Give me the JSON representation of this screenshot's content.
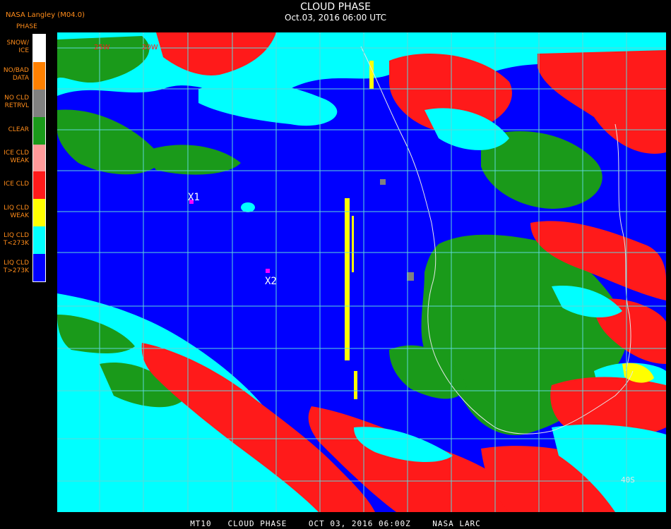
{
  "header": {
    "title": "CLOUD PHASE",
    "datetime": "Oct.03, 2016 06:00 UTC",
    "source": "NASA Langley (M04.0)"
  },
  "legend": {
    "title": "PHASE",
    "items": [
      {
        "label": "SNOW/\nICE",
        "color": "#ffffff"
      },
      {
        "label": "NO/BAD\nDATA",
        "color": "#ff8000"
      },
      {
        "label": "NO CLD\nRETRVL",
        "color": "#808080"
      },
      {
        "label": "CLEAR",
        "color": "#1a9a1a"
      },
      {
        "label": "ICE CLD\nWEAK",
        "color": "#ff9a9a"
      },
      {
        "label": "ICE CLD",
        "color": "#ff1a1a"
      },
      {
        "label": "LIQ CLD\nWEAK",
        "color": "#ffff00"
      },
      {
        "label": "LIQ CLD\nT<273K",
        "color": "#00ffff"
      },
      {
        "label": "LIQ CLD\nT>273K",
        "color": "#0000ff"
      }
    ]
  },
  "map": {
    "markers": [
      {
        "label": "X1",
        "color": "#ff00ff"
      },
      {
        "label": "X2",
        "color": "#ff00ff"
      }
    ],
    "grid_labels": [
      "25W",
      "20W",
      "40S"
    ],
    "grid_color": "#5fd7d7",
    "coast_color": "#e6e6e6"
  },
  "footer": {
    "text": "MT10   CLOUD PHASE    OCT 03, 2016 06:00Z    NASA LARC"
  }
}
